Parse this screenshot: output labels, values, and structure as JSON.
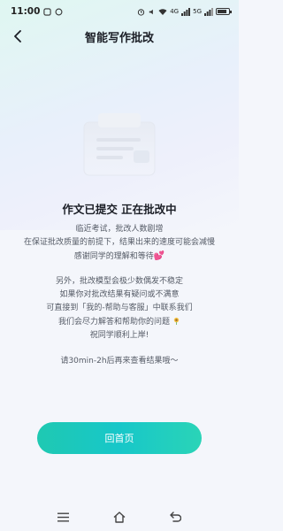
{
  "status_bar": {
    "time": "11:00",
    "network_label": "4G",
    "network_label_2": "5G",
    "battery_level": 0.8
  },
  "header": {
    "title": "智能写作批改",
    "back_icon": "chevron-left-icon"
  },
  "main": {
    "headline": "作文已提交 正在批改中",
    "paragraph_1": [
      "临近考试，批改人数剧增",
      "在保证批改质量的前提下，结果出来的速度可能会减慢",
      "感谢同学的理解和等待"
    ],
    "paragraph_2": [
      "另外，批改模型会极少数偶发不稳定",
      "如果你对批改结果有疑问或不满意",
      "可直接到「我的-帮助与客服」中联系我们",
      "我们会尽力解答和帮助你的问题",
      "祝同学顺利上岸!"
    ],
    "paragraph_3": "请30min-2h后再来查看结果哦～",
    "heart_emoji": "💕",
    "illustration_icon": "document-screen-icon"
  },
  "actions": {
    "home_button_label": "回首页"
  },
  "colors": {
    "accent": "#1fc9b2",
    "title": "#1b1e26",
    "body_text": "#555b66"
  },
  "system_nav": {
    "menu_icon": "menu-icon",
    "home_icon": "home-icon",
    "back_icon": "back-icon"
  }
}
